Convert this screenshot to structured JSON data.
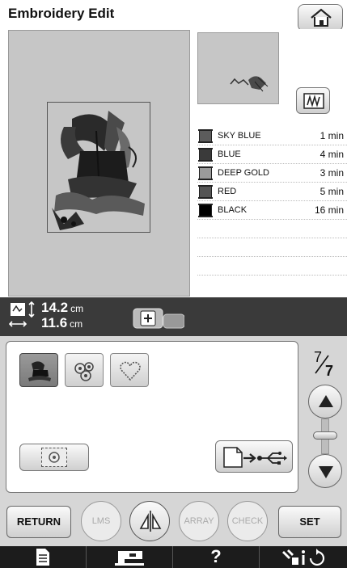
{
  "header": {
    "title": "Embroidery Edit",
    "home_icon": "home-icon"
  },
  "thread_colors": [
    {
      "name": "SKY BLUE",
      "time": "1 min",
      "color": "#5c5c5c"
    },
    {
      "name": "BLUE",
      "time": "4 min",
      "color": "#3a3a3a"
    },
    {
      "name": "DEEP GOLD",
      "time": "3 min",
      "color": "#9a9a9a"
    },
    {
      "name": "RED",
      "time": "5 min",
      "color": "#555555"
    },
    {
      "name": "BLACK",
      "time": "16 min",
      "color": "#000000"
    }
  ],
  "size": {
    "height": "14.2",
    "width": "11.6",
    "unit": "cm"
  },
  "pagination": {
    "current": "7",
    "total": "7"
  },
  "buttons": {
    "return": "RETURN",
    "lms": "LMS",
    "array": "ARRAY",
    "check": "CHECK",
    "set": "SET"
  },
  "toolbar_icons": [
    "page-icon",
    "machine-icon",
    "help-icon",
    "settings-icon"
  ],
  "toolbar": {
    "help": "?"
  }
}
